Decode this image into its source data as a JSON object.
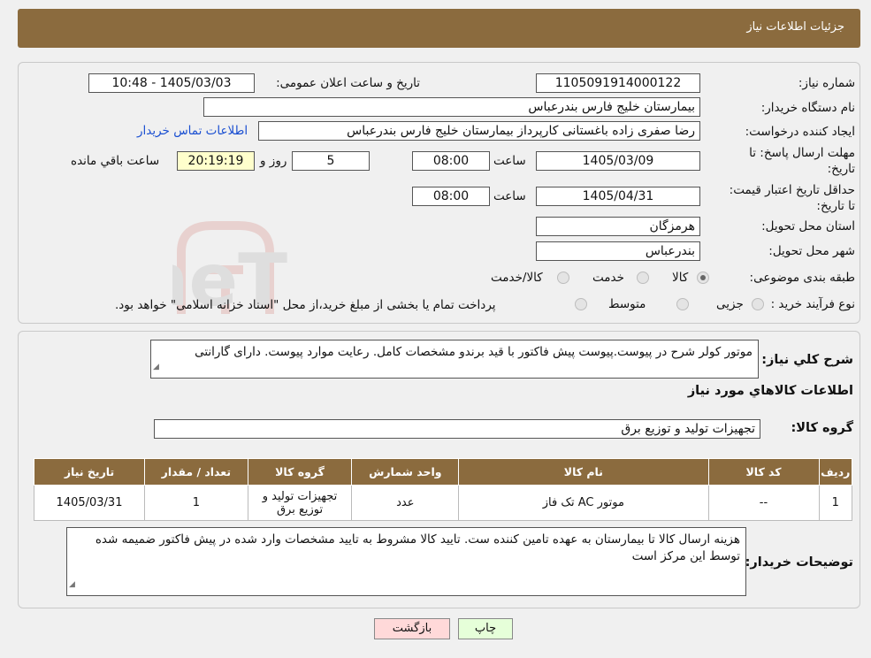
{
  "header": {
    "title": "جزئیات اطلاعات نیاز"
  },
  "need_number": {
    "label": "شماره نیاز:",
    "value": "1105091914000122"
  },
  "announce_date": {
    "label": "تاریخ و ساعت اعلان عمومی:",
    "value": "1405/03/03 - 10:48"
  },
  "buyer_org": {
    "label": "نام دستگاه خریدار:",
    "value": "بیمارستان خلیج فارس بندرعباس"
  },
  "requester": {
    "label": "ایجاد کننده درخواست:",
    "value": "رضا صفری زاده باغستانی کارپرداز بیمارستان خلیج فارس بندرعباس",
    "contact_link": "اطلاعات تماس خریدار"
  },
  "deadline": {
    "label": "مهلت ارسال پاسخ: تا تاریخ:",
    "date": "1405/03/09",
    "time_label": "ساعت",
    "time": "08:00",
    "days": "5",
    "days_label": "روز و",
    "remaining": "20:19:19",
    "remaining_label": "ساعت باقي مانده"
  },
  "price_validity": {
    "label": "حداقل تاریخ اعتبار قیمت: تا تاریخ:",
    "date": "1405/04/31",
    "time_label": "ساعت",
    "time": "08:00"
  },
  "province": {
    "label": "استان محل تحویل:",
    "value": "هرمزگان"
  },
  "city": {
    "label": "شهر محل تحویل:",
    "value": "بندرعباس"
  },
  "category": {
    "label": "طبقه بندی موضوعی:",
    "options": [
      "کالا",
      "خدمت",
      "کالا/خدمت"
    ],
    "selected": 0
  },
  "process": {
    "label": "نوع فرآیند خرید :",
    "options": [
      "جزیی",
      "متوسط"
    ],
    "note": "پرداخت تمام یا بخشی از مبلغ خرید،از محل \"اسناد خزانه اسلامی\" خواهد بود."
  },
  "description": {
    "label": "شرح کلي نياز:",
    "value": "موتور کولر شرح در پیوست.پیوست پیش فاکتور با قید برندو مشخصات کامل. رعایت موارد پیوست. دارای گارانتی"
  },
  "goods_info_title": "اطلاعات کالاهاي مورد نياز",
  "goods_group": {
    "label": "گروه کالا:",
    "value": "تجهیزات تولید و توزیع برق"
  },
  "table": {
    "headers": [
      "ردیف",
      "کد کالا",
      "نام کالا",
      "واحد شمارش",
      "گروه کالا",
      "تعداد / مقدار",
      "تاریخ نیاز"
    ],
    "rows": [
      [
        "1",
        "--",
        "موتور AC تک فاز",
        "عدد",
        "تجهیزات تولید و توزیع برق",
        "1",
        "1405/03/31"
      ]
    ]
  },
  "buyer_notes": {
    "label": "توضیحات خریدار:",
    "value": "هزینه ارسال کالا تا بیمارستان به عهده تامین کننده ست. تایید کالا مشروط به تایید مشخصات وارد شده در پیش فاکتور ضمیمه شده توسط این مرکز است"
  },
  "buttons": {
    "print": "چاپ",
    "back": "بازگشت"
  },
  "watermark": {
    "text": "AriaTender.neT"
  },
  "colors": {
    "header": "#8b6b3e",
    "link": "#1a4fd1",
    "remaining_bg": "#ffffcc",
    "back_btn": "#ffd9d9",
    "print_btn": "#e6ffd9"
  }
}
